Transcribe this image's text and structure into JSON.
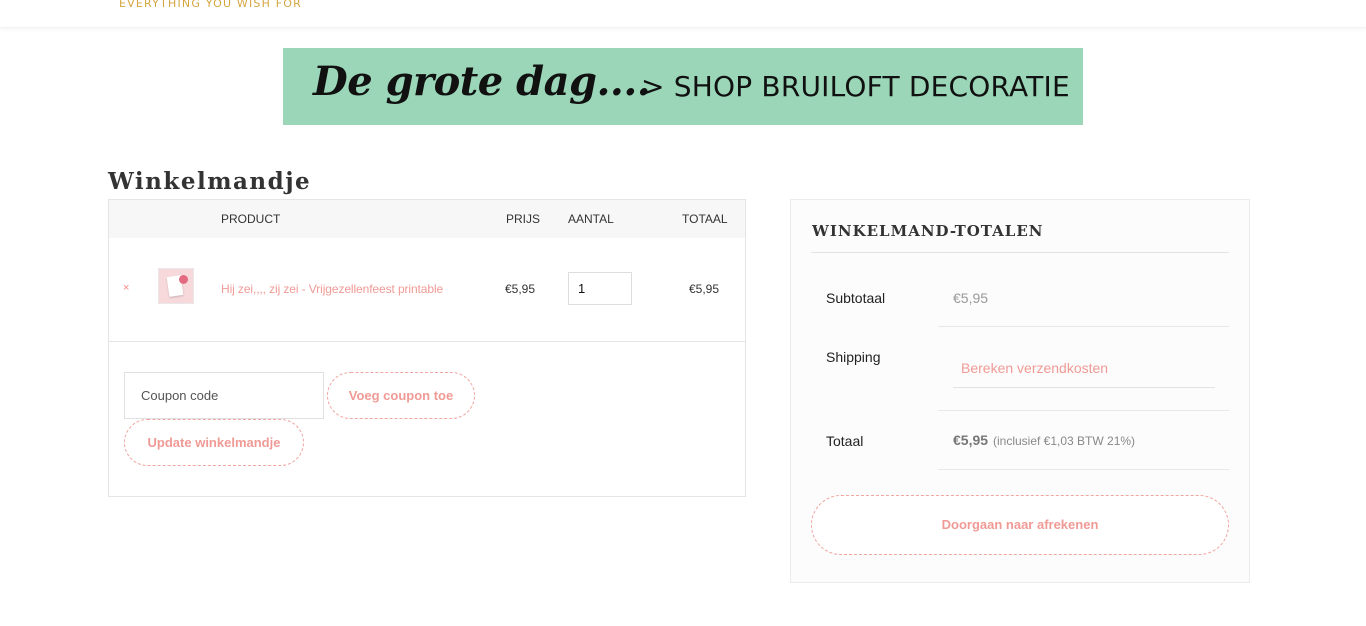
{
  "header": {
    "tagline": "EVERYTHING YOU WISH FOR"
  },
  "banner": {
    "script_text": "De grote dag....",
    "cta_text": "> SHOP BRUILOFT DECORATIE"
  },
  "page": {
    "title": "Winkelmandje"
  },
  "cart": {
    "headers": {
      "product": "PRODUCT",
      "price": "PRIJS",
      "quantity": "AANTAL",
      "total": "TOTAAL"
    },
    "items": [
      {
        "remove_icon": "×",
        "name": "Hij zei,,,, zij zei - Vrijgezellenfeest printable",
        "price": "€5,95",
        "quantity": "1",
        "total": "€5,95"
      }
    ],
    "coupon": {
      "placeholder": "Coupon code",
      "apply_label": "Voeg coupon toe"
    },
    "update_label": "Update winkelmandje"
  },
  "totals": {
    "title": "WINKELMAND-TOTALEN",
    "subtotal_label": "Subtotaal",
    "subtotal_value": "€5,95",
    "shipping_label": "Shipping",
    "shipping_link": "Bereken verzendkosten",
    "total_label": "Totaal",
    "total_value": "€5,95",
    "tax_note": "(inclusief €1,03 BTW 21%)",
    "checkout_label": "Doorgaan naar afrekenen"
  },
  "colors": {
    "accent_pink": "#f09a95",
    "banner_green": "#9ad6b7",
    "tagline_gold": "#d4a640"
  }
}
